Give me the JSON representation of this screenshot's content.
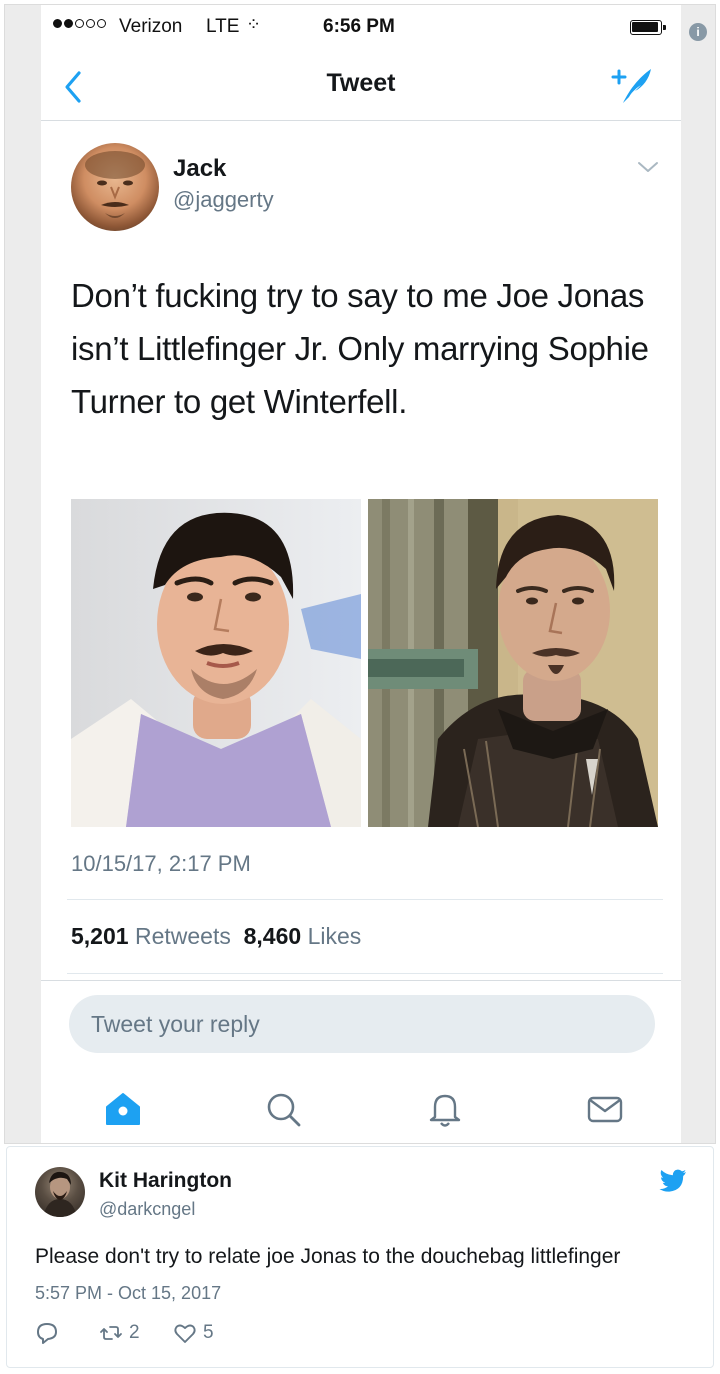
{
  "status_bar": {
    "carrier": "Verizon",
    "network": "LTE",
    "time": "6:56 PM"
  },
  "nav": {
    "title": "Tweet"
  },
  "tweet": {
    "author_name": "Jack",
    "author_handle": "@jaggerty",
    "text": "Don’t fucking try to say to me Joe Jonas isn’t Littlefinger Jr. Only marrying Sophie Turner to get Winterfell.",
    "timestamp": "10/15/17, 2:17 PM",
    "retweet_count": "5,201",
    "retweet_label": "Retweets",
    "like_count": "8,460",
    "like_label": "Likes",
    "reply_placeholder": "Tweet your reply"
  },
  "tab_bar": {
    "icons": [
      "home-icon",
      "search-icon",
      "notifications-icon",
      "messages-icon"
    ],
    "active": "home-icon"
  },
  "reply": {
    "author_name": "Kit Harington",
    "author_handle": "@darkcngel",
    "text": "Please don't try to relate joe Jonas to the douchebag littlefinger",
    "timestamp": "5:57 PM - Oct 15, 2017",
    "retweet_count": "2",
    "like_count": "5"
  },
  "colors": {
    "twitter_blue": "#1da1f2",
    "text_secondary": "#657786",
    "reply_box_bg": "#e6ecf0"
  }
}
